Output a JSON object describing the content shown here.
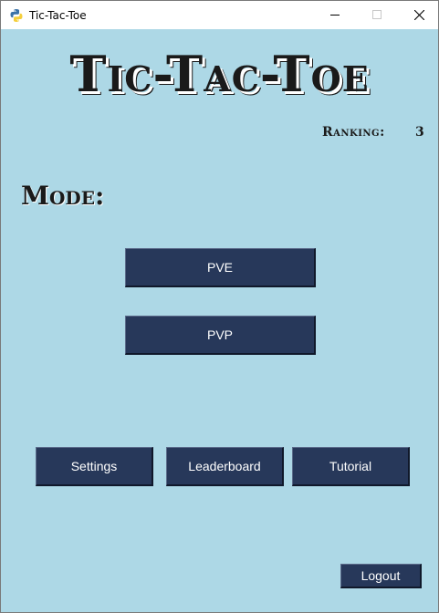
{
  "window": {
    "title": "Tic-Tac-Toe",
    "icon": "python-icon",
    "controls": [
      "minimize-icon",
      "maximize-icon",
      "close-icon"
    ]
  },
  "header": {
    "game_title": "Tic-Tac-Toe",
    "ranking_label": "Ranking:",
    "ranking_value": "3"
  },
  "mode": {
    "label": "Mode:",
    "pve_label": "PVE",
    "pvp_label": "PVP"
  },
  "menu": {
    "settings_label": "Settings",
    "leaderboard_label": "Leaderboard",
    "tutorial_label": "Tutorial"
  },
  "footer": {
    "logout_label": "Logout"
  },
  "colors": {
    "background": "#add8e6",
    "button": "#27385a",
    "button_text": "#ffffff",
    "heading_text": "#1a1a1a"
  }
}
